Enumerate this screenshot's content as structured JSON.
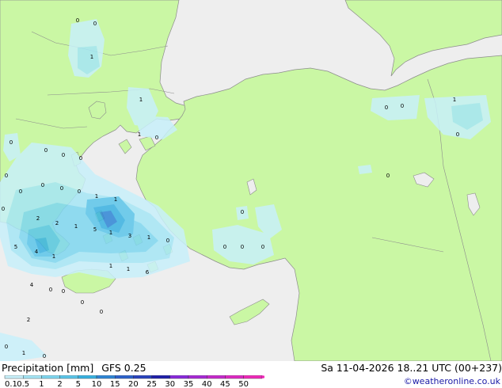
{
  "header": {
    "product": "Precipitation [mm]",
    "model": "GFS 0.25",
    "valid_time": "Sa 11-04-2026 18..21 UTC (00+237)",
    "credit": "©weatheronline.co.uk"
  },
  "legend": {
    "labels": [
      "0.1",
      "0.5",
      "1",
      "2",
      "5",
      "10",
      "15",
      "20",
      "25",
      "30",
      "35",
      "40",
      "45",
      "50"
    ],
    "colors": [
      "#c8f0fa",
      "#a6e6f6",
      "#7fd7f0",
      "#5cc6ea",
      "#3ab2e2",
      "#2f86d6",
      "#2d63cc",
      "#2a44be",
      "#2020aa",
      "#8a2adc",
      "#a82ad6",
      "#c62acc",
      "#de2ac4",
      "#f02aba"
    ]
  },
  "map": {
    "land_color": "#caf7a4",
    "sea_color": "#eeeeee",
    "border_color": "#8c8c8c",
    "value_labels": [
      "0",
      "0",
      "1",
      "1",
      "1",
      "0",
      "0",
      "0",
      "0",
      "0",
      "0",
      "0",
      "0",
      "0",
      "0",
      "0",
      "1",
      "1",
      "2",
      "2",
      "1",
      "5",
      "1",
      "3",
      "1",
      "0",
      "5",
      "4",
      "1",
      "1",
      "1",
      "6",
      "4",
      "0",
      "2",
      "0",
      "1",
      "0",
      "0",
      "0",
      "0",
      "0",
      "0",
      "0",
      "1",
      "0",
      "0",
      "0",
      "0",
      "0"
    ]
  }
}
